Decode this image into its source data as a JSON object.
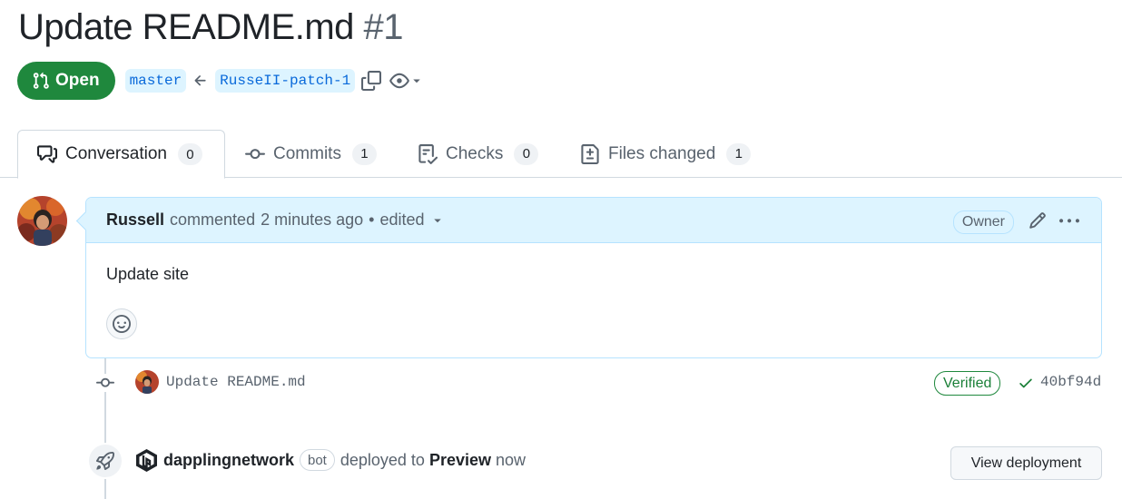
{
  "pr": {
    "title": "Update README.md",
    "number": "#1",
    "state": "Open",
    "base_branch": "master",
    "head_branch": "RusseII-patch-1"
  },
  "tabs": [
    {
      "label": "Conversation",
      "count": "0",
      "icon": "comment-discussion-icon"
    },
    {
      "label": "Commits",
      "count": "1",
      "icon": "git-commit-icon"
    },
    {
      "label": "Checks",
      "count": "0",
      "icon": "checklist-icon"
    },
    {
      "label": "Files changed",
      "count": "1",
      "icon": "file-diff-icon"
    }
  ],
  "comment": {
    "author": "Russell",
    "action": "commented",
    "time": "2 minutes ago",
    "separator": "•",
    "edited": "edited",
    "role": "Owner",
    "body": "Update site"
  },
  "commit": {
    "message": "Update README.md",
    "verified": "Verified",
    "sha": "40bf94d"
  },
  "deployment": {
    "actor": "dapplingnetwork",
    "badge": "bot",
    "action": "deployed to",
    "environment": "Preview",
    "when": "now",
    "button": "View deployment"
  },
  "colors": {
    "open_green": "#1f883d",
    "link_blue": "#0969da",
    "branch_bg": "#ddf4ff",
    "verified_green": "#1a7f37"
  }
}
